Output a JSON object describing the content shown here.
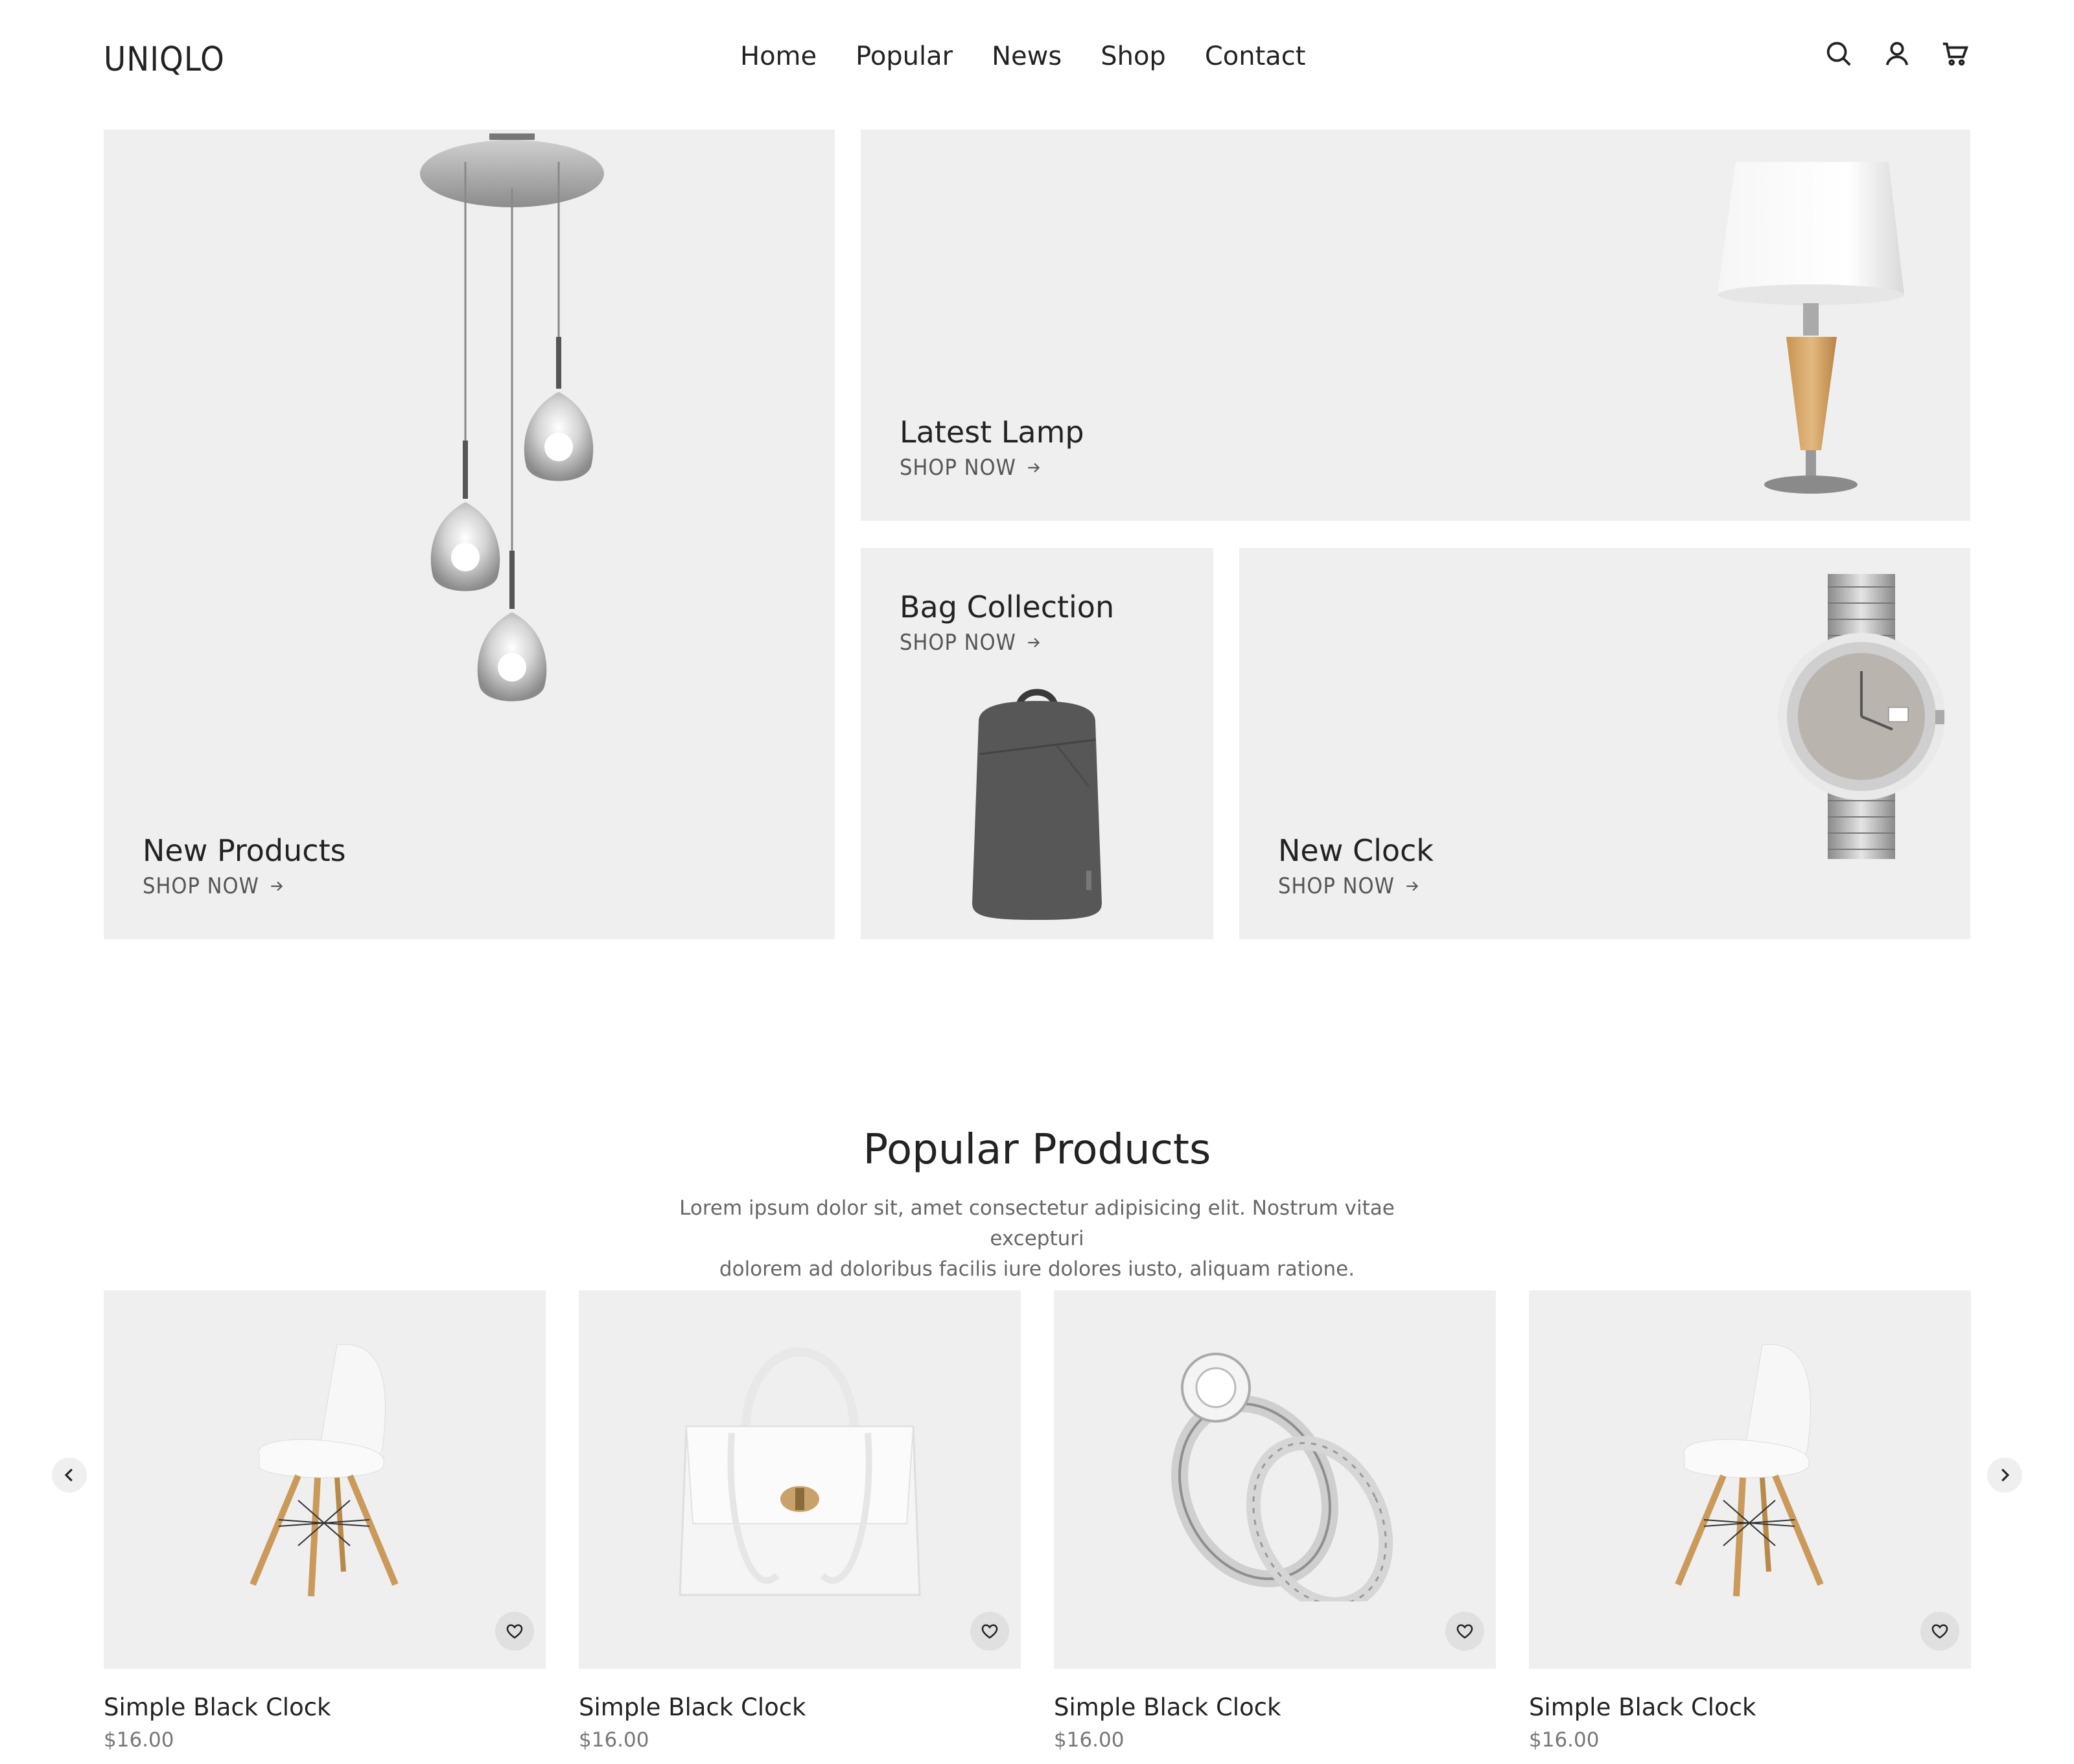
{
  "header": {
    "logo": "UNIQLO",
    "nav": [
      "Home",
      "Popular",
      "News",
      "Shop",
      "Contact"
    ],
    "icons": [
      "search-icon",
      "user-icon",
      "cart-icon"
    ]
  },
  "banners": [
    {
      "title": "New Products",
      "cta": "SHOP NOW",
      "image": "pendant-lamp"
    },
    {
      "title": "Latest Lamp",
      "cta": "SHOP NOW",
      "image": "table-lamp"
    },
    {
      "title": "Bag Collection",
      "cta": "SHOP NOW",
      "image": "backpack"
    },
    {
      "title": "New Clock",
      "cta": "SHOP NOW",
      "image": "wristwatch"
    }
  ],
  "popular": {
    "title": "Popular Products",
    "description_line1": "Lorem ipsum dolor sit, amet consectetur adipisicing elit. Nostrum vitae excepturi",
    "description_line2": "dolorem ad doloribus facilis iure dolores iusto, aliquam ratione.",
    "products": [
      {
        "name": "Simple Black Clock",
        "price": "$16.00",
        "image": "white-chair"
      },
      {
        "name": "Simple Black Clock",
        "price": "$16.00",
        "image": "white-handbag"
      },
      {
        "name": "Simple Black Clock",
        "price": "$16.00",
        "image": "diamond-rings"
      },
      {
        "name": "Simple Black Clock",
        "price": "$16.00",
        "image": "white-chair"
      }
    ]
  },
  "colors": {
    "tile_bg": "#efefef",
    "text": "#222222",
    "muted": "#777777"
  }
}
